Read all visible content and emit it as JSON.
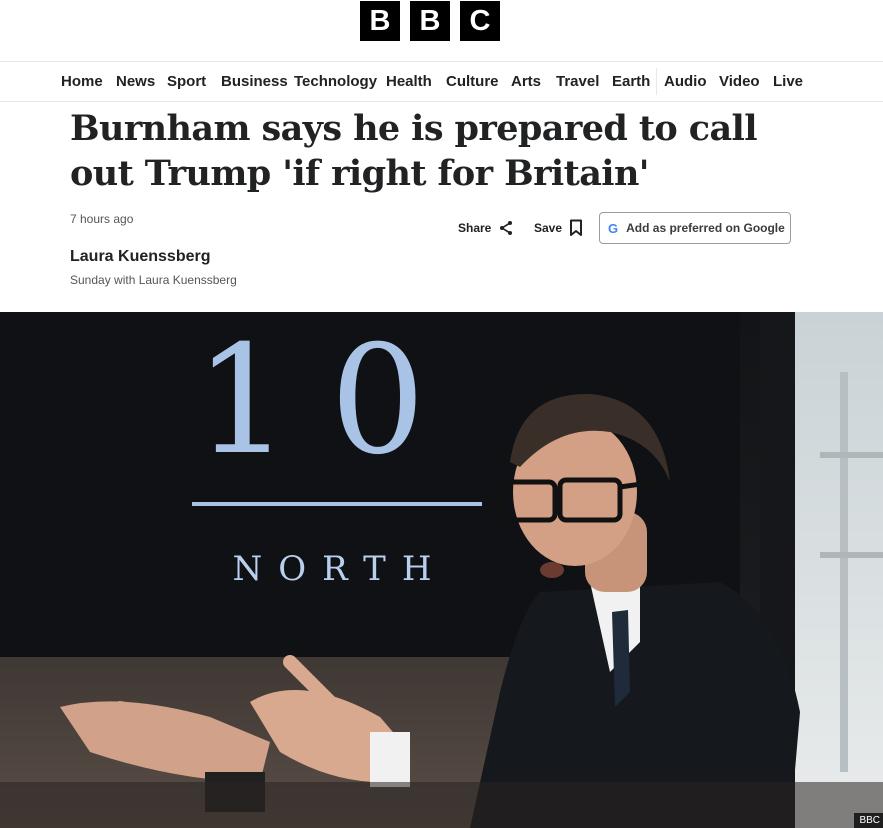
{
  "brand": {
    "letters": [
      "B",
      "B",
      "C"
    ]
  },
  "nav": {
    "items": [
      "Home",
      "News",
      "Sport",
      "Business",
      "Technology",
      "Health",
      "Culture",
      "Arts",
      "Travel",
      "Earth",
      "Audio",
      "Video",
      "Live"
    ]
  },
  "article": {
    "headline": "Burnham says he is prepared to call out Trump 'if right for Britain'",
    "timestamp": "7 hours ago",
    "author": "Laura Kuenssberg",
    "author_role": "Sunday with Laura Kuenssberg"
  },
  "actions": {
    "share_label": "Share",
    "save_label": "Save",
    "google_label": "Add as preferred on Google",
    "google_letter": "G"
  },
  "image": {
    "sign_number": "10",
    "sign_text": "NORTH",
    "credit": "BBC"
  },
  "colors": {
    "text": "#202224",
    "muted": "#545658",
    "google_blue": "#4285f4"
  }
}
